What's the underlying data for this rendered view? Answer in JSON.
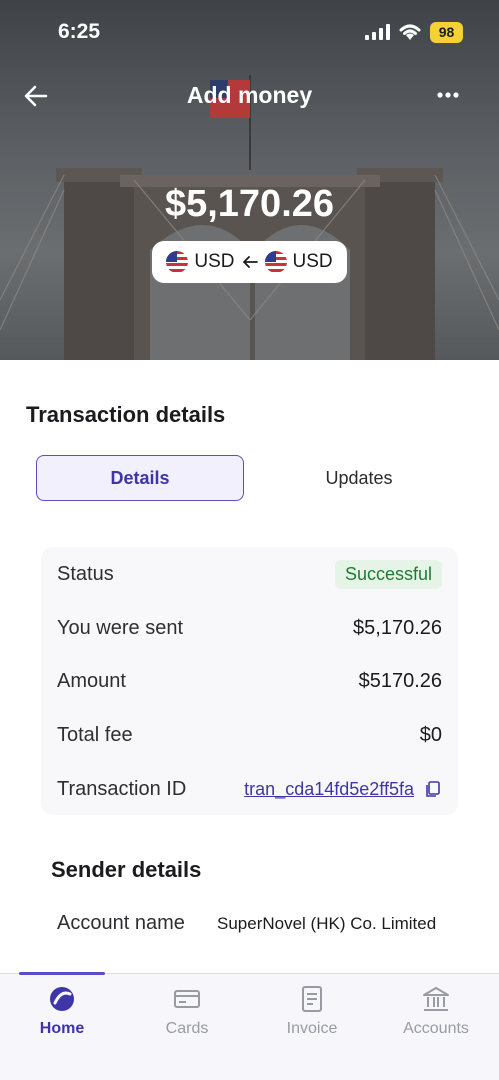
{
  "status_bar": {
    "time": "6:25",
    "battery": "98"
  },
  "header": {
    "title": "Add money",
    "back_icon": "arrow-left-icon",
    "more_icon": "more-dots-icon"
  },
  "hero": {
    "amount": "$5,170.26",
    "from_currency": "USD",
    "to_currency": "USD"
  },
  "transaction": {
    "title": "Transaction details",
    "tabs": [
      {
        "label": "Details",
        "active": true
      },
      {
        "label": "Updates",
        "active": false
      }
    ],
    "rows": {
      "status_label": "Status",
      "status_value": "Successful",
      "sent_label": "You were sent",
      "sent_value": "$5,170.26",
      "amount_label": "Amount",
      "amount_value": "$5170.26",
      "fee_label": "Total fee",
      "fee_value": "$0",
      "id_label": "Transaction ID",
      "id_value": "tran_cda14fd5e2ff5fa"
    }
  },
  "sender": {
    "title": "Sender details",
    "account_name_label": "Account name",
    "account_name_value": "SuperNovel (HK) Co. Limited"
  },
  "tabbar": {
    "items": [
      {
        "label": "Home",
        "icon": "home-logo-icon",
        "active": true
      },
      {
        "label": "Cards",
        "icon": "card-icon",
        "active": false
      },
      {
        "label": "Invoice",
        "icon": "invoice-icon",
        "active": false
      },
      {
        "label": "Accounts",
        "icon": "bank-icon",
        "active": false
      }
    ]
  },
  "colors": {
    "accent": "#5a4fc8",
    "success": "#1e7b34",
    "success_bg": "#e6f4e8",
    "status_battery": "#f5d233"
  }
}
